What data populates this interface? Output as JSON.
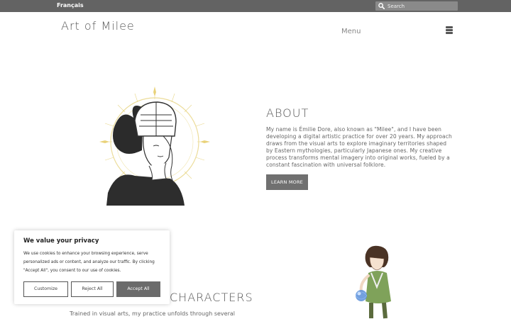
{
  "topbar": {
    "language_link": "Français",
    "search_placeholder": "Search"
  },
  "header": {
    "site_title": "Art of Milee",
    "menu_label": "Menu"
  },
  "about": {
    "title": "ABOUT",
    "text": "My name is Émilie Dore, also known as \"Milee\", and I have been developing a digital artistic practice for over 20 years. My approach draws from the visual arts to explore imaginary territories shaped by Eastern mythologies, particularly Japanese ones. My creative process transforms mental imagery into original works, fueled by a constant fascination with universal folklore.",
    "button_label": "LEARN MORE"
  },
  "characters": {
    "title": "CHARACTERS",
    "text": "Trained in visual arts, my practice unfolds through several artistic"
  },
  "cookie_banner": {
    "title": "We value your privacy",
    "text": "We use cookies to enhance your browsing experience, serve personalized ads or content, and analyze our traffic. By clicking \"Accept All\", you consent to our use of cookies.",
    "customize_label": "Customize",
    "reject_label": "Reject All",
    "accept_label": "Accept All"
  },
  "colors": {
    "topbar_bg": "#636363",
    "button_bg": "#707070",
    "accent_gold": "#e0c96a"
  },
  "icons": [
    "search-icon",
    "hamburger-menu-icon"
  ]
}
